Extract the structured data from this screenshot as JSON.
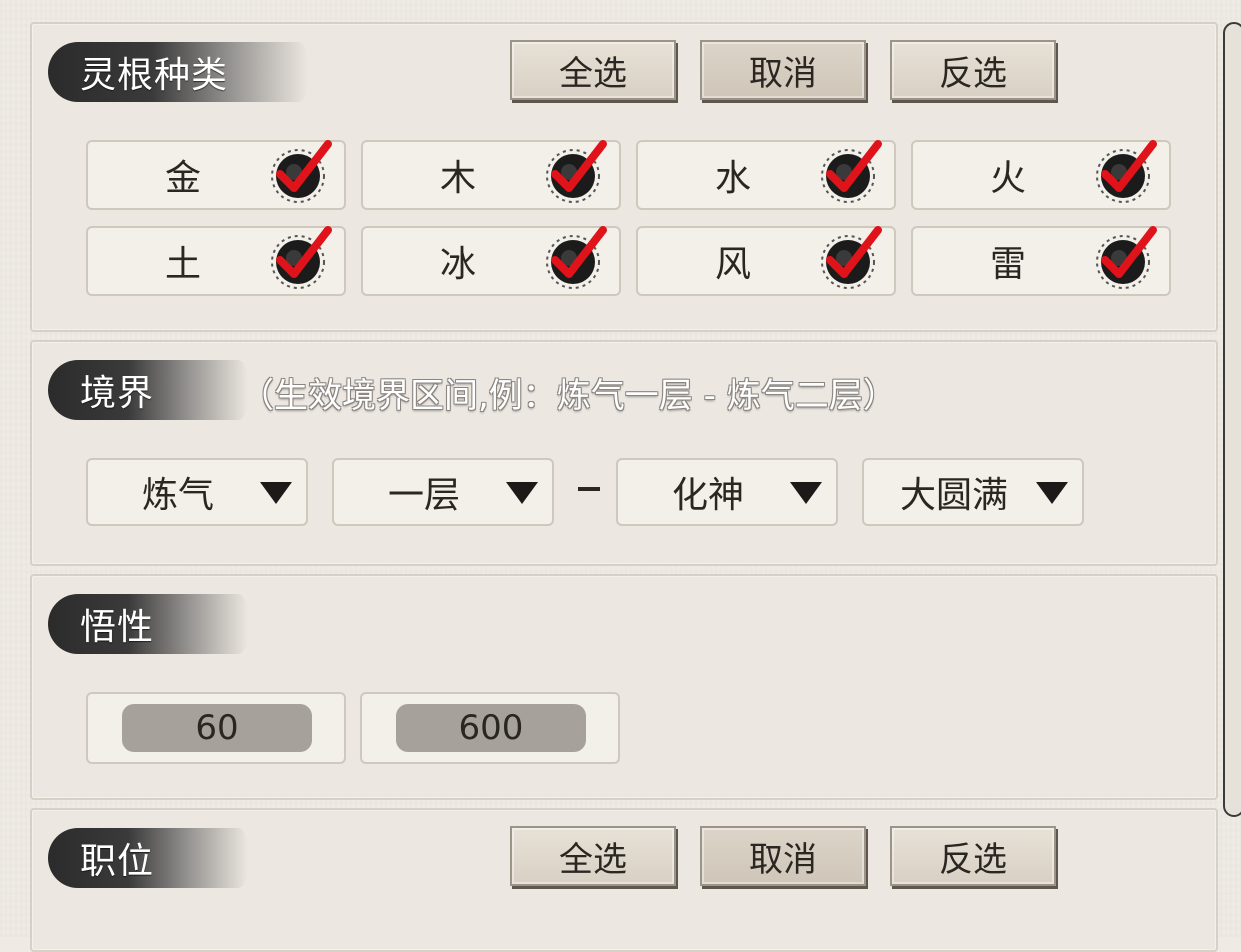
{
  "sections": {
    "spirit_root": {
      "title": "灵根种类",
      "buttons": {
        "select_all": "全选",
        "cancel": "取消",
        "invert": "反选"
      },
      "items": [
        {
          "label": "金",
          "checked": true
        },
        {
          "label": "木",
          "checked": true
        },
        {
          "label": "水",
          "checked": true
        },
        {
          "label": "火",
          "checked": true
        },
        {
          "label": "土",
          "checked": true
        },
        {
          "label": "冰",
          "checked": true
        },
        {
          "label": "风",
          "checked": true
        },
        {
          "label": "雷",
          "checked": true
        }
      ]
    },
    "realm": {
      "title": "境界",
      "hint": "（生效境界区间,例：炼气一层 - 炼气二层）",
      "from_realm": "炼气",
      "from_layer": "一层",
      "separator": "–",
      "to_realm": "化神",
      "to_layer": "大圆满"
    },
    "comprehension": {
      "title": "悟性",
      "min": "60",
      "max": "600"
    },
    "position": {
      "title": "职位",
      "buttons": {
        "select_all": "全选",
        "cancel": "取消",
        "invert": "反选"
      }
    }
  },
  "icons": {
    "check": "check-icon",
    "dropdown": "triangle-down-icon"
  },
  "colors": {
    "check_red": "#e0121a",
    "ink": "#2b2b2b"
  }
}
